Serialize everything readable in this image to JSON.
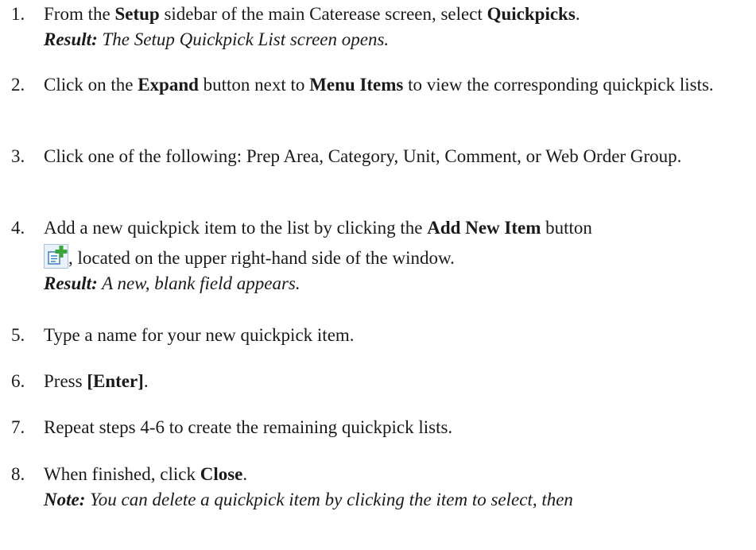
{
  "steps": [
    {
      "number": "1.",
      "t1": "From the ",
      "b1": "Setup",
      "t2": " sidebar of the main Caterease screen, select ",
      "b2": "Quickpicks",
      "t3": ".",
      "result_label": "Result:",
      "result_text": " The Setup Quickpick List screen opens."
    },
    {
      "number": "2.",
      "t1": "Click on the ",
      "b1": "Expand",
      "t2": " button next to ",
      "b2": "Menu Items",
      "t3": " to view the corresponding quickpick lists."
    },
    {
      "number": "3.",
      "t1": "Click one of the following: Prep Area, Category, Unit, Comment, or Web Order Group."
    },
    {
      "number": "4.",
      "t1": "Add a new quickpick item to the list by clicking the ",
      "b1": "Add New Item",
      "t2": " button",
      "t3": ", located on the upper right-hand side of the window.",
      "result_label": "Result:",
      "result_text": " A new, blank field appears."
    },
    {
      "number": "5.",
      "t1": "Type a name for your new quickpick item."
    },
    {
      "number": "6.",
      "t1": "Press ",
      "b1": "[Enter]",
      "t2": "."
    },
    {
      "number": "7.",
      "t1": "Repeat steps 4-6 to create the remaining quickpick lists."
    },
    {
      "number": "8.",
      "t1": "When finished, click ",
      "b1": "Close",
      "t2": ".",
      "note_label": "Note:",
      "note_text": " You can delete a quickpick item by clicking the item to select, then"
    }
  ],
  "icons": {
    "add_new_item": "add-new-item-icon"
  },
  "colors": {
    "icon_green": "#3aa63a",
    "icon_blue": "#3b7fc4"
  }
}
